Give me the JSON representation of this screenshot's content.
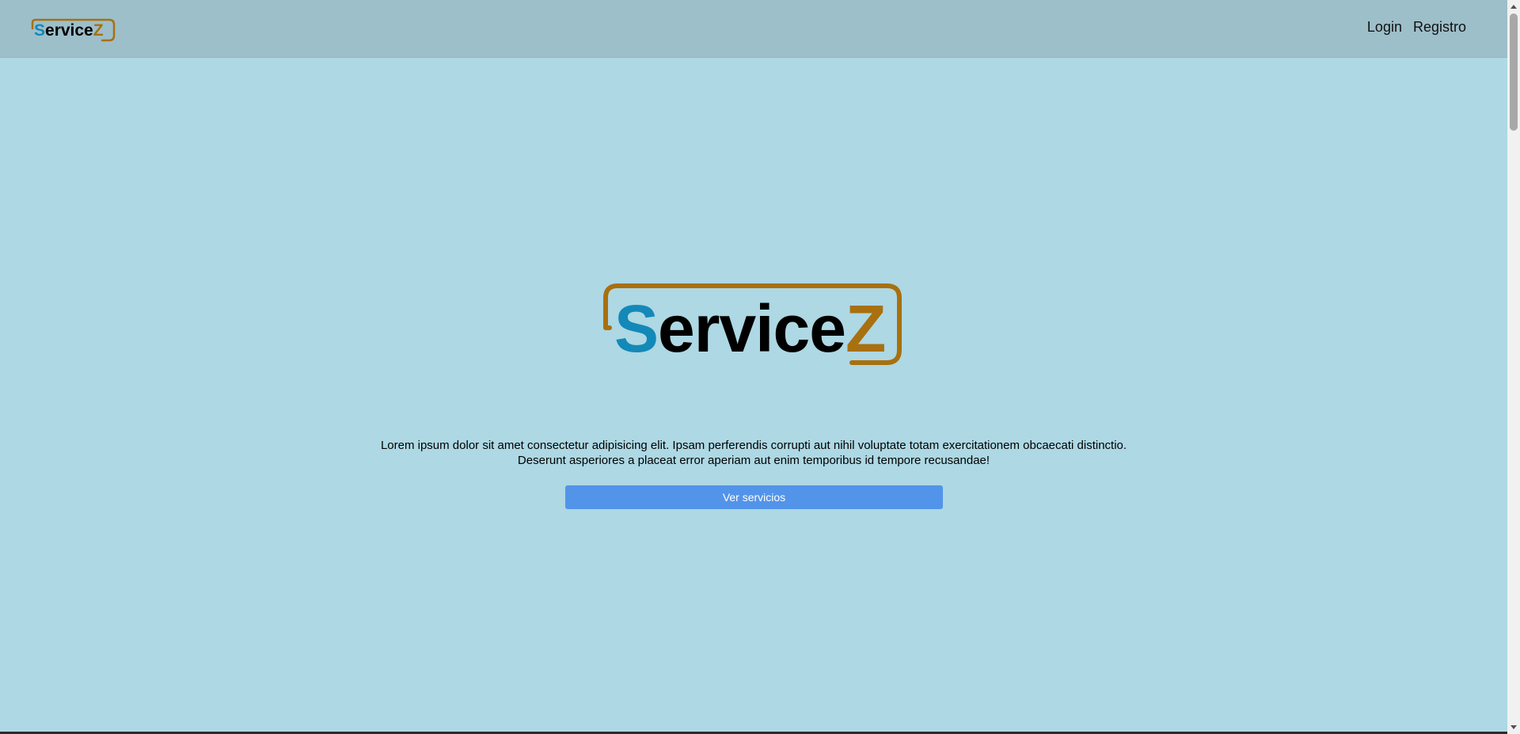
{
  "navbar": {
    "logo": {
      "text_s": "S",
      "text_rest": "ervice",
      "text_z": "Z"
    },
    "links": [
      {
        "label": "Login"
      },
      {
        "label": "Registro"
      }
    ]
  },
  "hero": {
    "logo": {
      "text_s": "S",
      "text_rest": "ervice",
      "text_z": "Z"
    },
    "description": "Lorem ipsum dolor sit amet consectetur adipisicing elit. Ipsam perferendis corrupti aut nihil voluptate totam exercitationem obcaecati distinctio. Deserunt asperiores a placeat error aperiam aut enim temporibus id tempore recusandae!",
    "button_label": "Ver servicios"
  },
  "colors": {
    "page_background": "#add8e4",
    "navbar_background": "#9dbfca",
    "logo_blue": "#1389b8",
    "logo_gold": "#a8700f",
    "button_blue": "#5294ea"
  }
}
